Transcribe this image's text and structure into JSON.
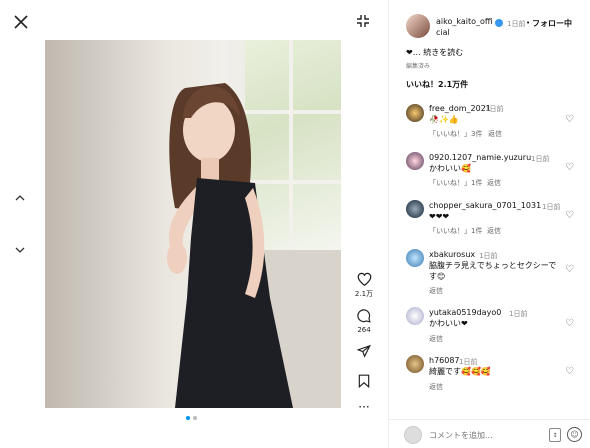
{
  "post": {
    "username": "aiko_kaito_offi",
    "username_cont": "cial",
    "time": "1日前",
    "follow_label": "フォロー中",
    "caption": "❤︎… 続きを読む",
    "edited": "編集済み",
    "likes": "いいね！2.1万件",
    "like_count": "2.1万",
    "comment_count": "264",
    "colors": {
      "accent": "#0095f6",
      "verified": "#3897f0"
    }
  },
  "comments": [
    {
      "user": "free_dom_2021",
      "time": "1日前",
      "text": "🥀✨👍",
      "meta1": "「いいね！」3件",
      "reply": "返信"
    },
    {
      "user": "0920.1207_namie.yuzuru",
      "time": "1日前",
      "text": "かわいい🥰",
      "meta1": "「いいね！」1件",
      "reply": "返信"
    },
    {
      "user": "chopper_sakura_0701_1031",
      "time": "1日前",
      "text": "❤❤❤",
      "meta1": "「いいね！」1件",
      "reply": "返信"
    },
    {
      "user": "xbakurosux",
      "time": "1日前",
      "text": "脇腹チラ見えでちょっとセクシーで",
      "text2": "す😊",
      "reply": "返信"
    },
    {
      "user": "yutaka0519dayo0",
      "time": "1日前",
      "text": "かわいい❤",
      "reply": "返信"
    },
    {
      "user": "h76087",
      "time": "1日前",
      "text": "綺麗です🥰🥰🥰",
      "reply": "返信"
    }
  ],
  "comment_input": {
    "placeholder": "コメントを追加...",
    "emoji_icon": "smile-icon",
    "gif_icon": "gif-sticker-icon"
  },
  "icons": [
    "close-icon",
    "collapse-icon",
    "arrow-up-icon",
    "arrow-down-icon",
    "heart-icon",
    "comment-icon",
    "share-icon",
    "bookmark-icon",
    "more-icon"
  ]
}
